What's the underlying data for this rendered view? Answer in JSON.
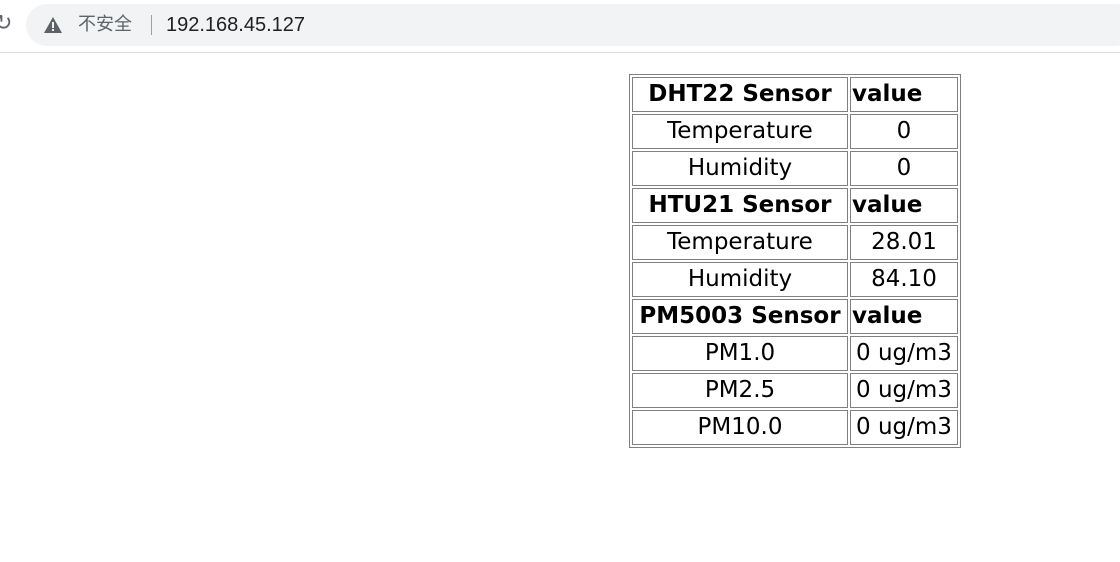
{
  "browser": {
    "security_label": "不安全",
    "url": "192.168.45.127",
    "warn_icon": "warning-triangle-icon"
  },
  "table": {
    "sections": [
      {
        "header": "DHT22 Sensor",
        "value_header": "value",
        "rows": [
          {
            "name": "Temperature",
            "value": "0"
          },
          {
            "name": "Humidity",
            "value": "0"
          }
        ]
      },
      {
        "header": "HTU21 Sensor",
        "value_header": "value",
        "rows": [
          {
            "name": "Temperature",
            "value": "28.01"
          },
          {
            "name": "Humidity",
            "value": "84.10"
          }
        ]
      },
      {
        "header": "PM5003 Sensor",
        "value_header": "value",
        "rows": [
          {
            "name": "PM1.0",
            "value": "0 ug/m3"
          },
          {
            "name": "PM2.5",
            "value": "0 ug/m3"
          },
          {
            "name": "PM10.0",
            "value": "0 ug/m3"
          }
        ]
      }
    ]
  }
}
